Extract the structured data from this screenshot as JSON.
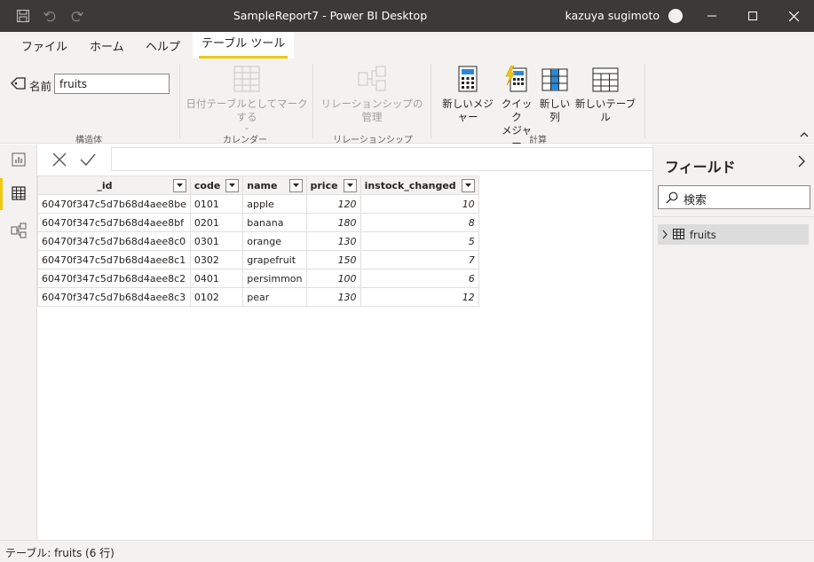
{
  "window": {
    "title": "SampleReport7 - Power BI Desktop",
    "user": "kazuya sugimoto"
  },
  "tabs": [
    {
      "label": "ファイル"
    },
    {
      "label": "ホーム"
    },
    {
      "label": "ヘルプ"
    },
    {
      "label": "テーブル ツール"
    }
  ],
  "ribbon": {
    "name_label": "名前",
    "name_value": "fruits",
    "mark_date_table": "日付テーブルとしてマークする",
    "manage_relationships": "リレーションシップの管理",
    "new_measure": "新しいメジャー",
    "quick_measure_1": "クイック",
    "quick_measure_2": "メジャー",
    "new_column": "新しい列",
    "new_table": "新しいテーブル",
    "groups": {
      "structure": "構造体",
      "calendar": "カレンダー",
      "relationships": "リレーションシップ",
      "calculations": "計算"
    }
  },
  "grid": {
    "headers": [
      "_id",
      "code",
      "name",
      "price",
      "instock_changed"
    ],
    "rows": [
      [
        "60470f347c5d7b68d4aee8be",
        "0101",
        "apple",
        "120",
        "10"
      ],
      [
        "60470f347c5d7b68d4aee8bf",
        "0201",
        "banana",
        "180",
        "8"
      ],
      [
        "60470f347c5d7b68d4aee8c0",
        "0301",
        "orange",
        "130",
        "5"
      ],
      [
        "60470f347c5d7b68d4aee8c1",
        "0302",
        "grapefruit",
        "150",
        "7"
      ],
      [
        "60470f347c5d7b68d4aee8c2",
        "0401",
        "persimmon",
        "100",
        "6"
      ],
      [
        "60470f347c5d7b68d4aee8c3",
        "0102",
        "pear",
        "130",
        "12"
      ]
    ]
  },
  "fields_pane": {
    "title": "フィールド",
    "search_placeholder": "検索",
    "tables": [
      {
        "name": "fruits"
      }
    ]
  },
  "status": {
    "text": "テーブル: fruits (6 行)"
  },
  "colors": {
    "accent": "#f2c811",
    "titlebar": "#3b3a39"
  }
}
